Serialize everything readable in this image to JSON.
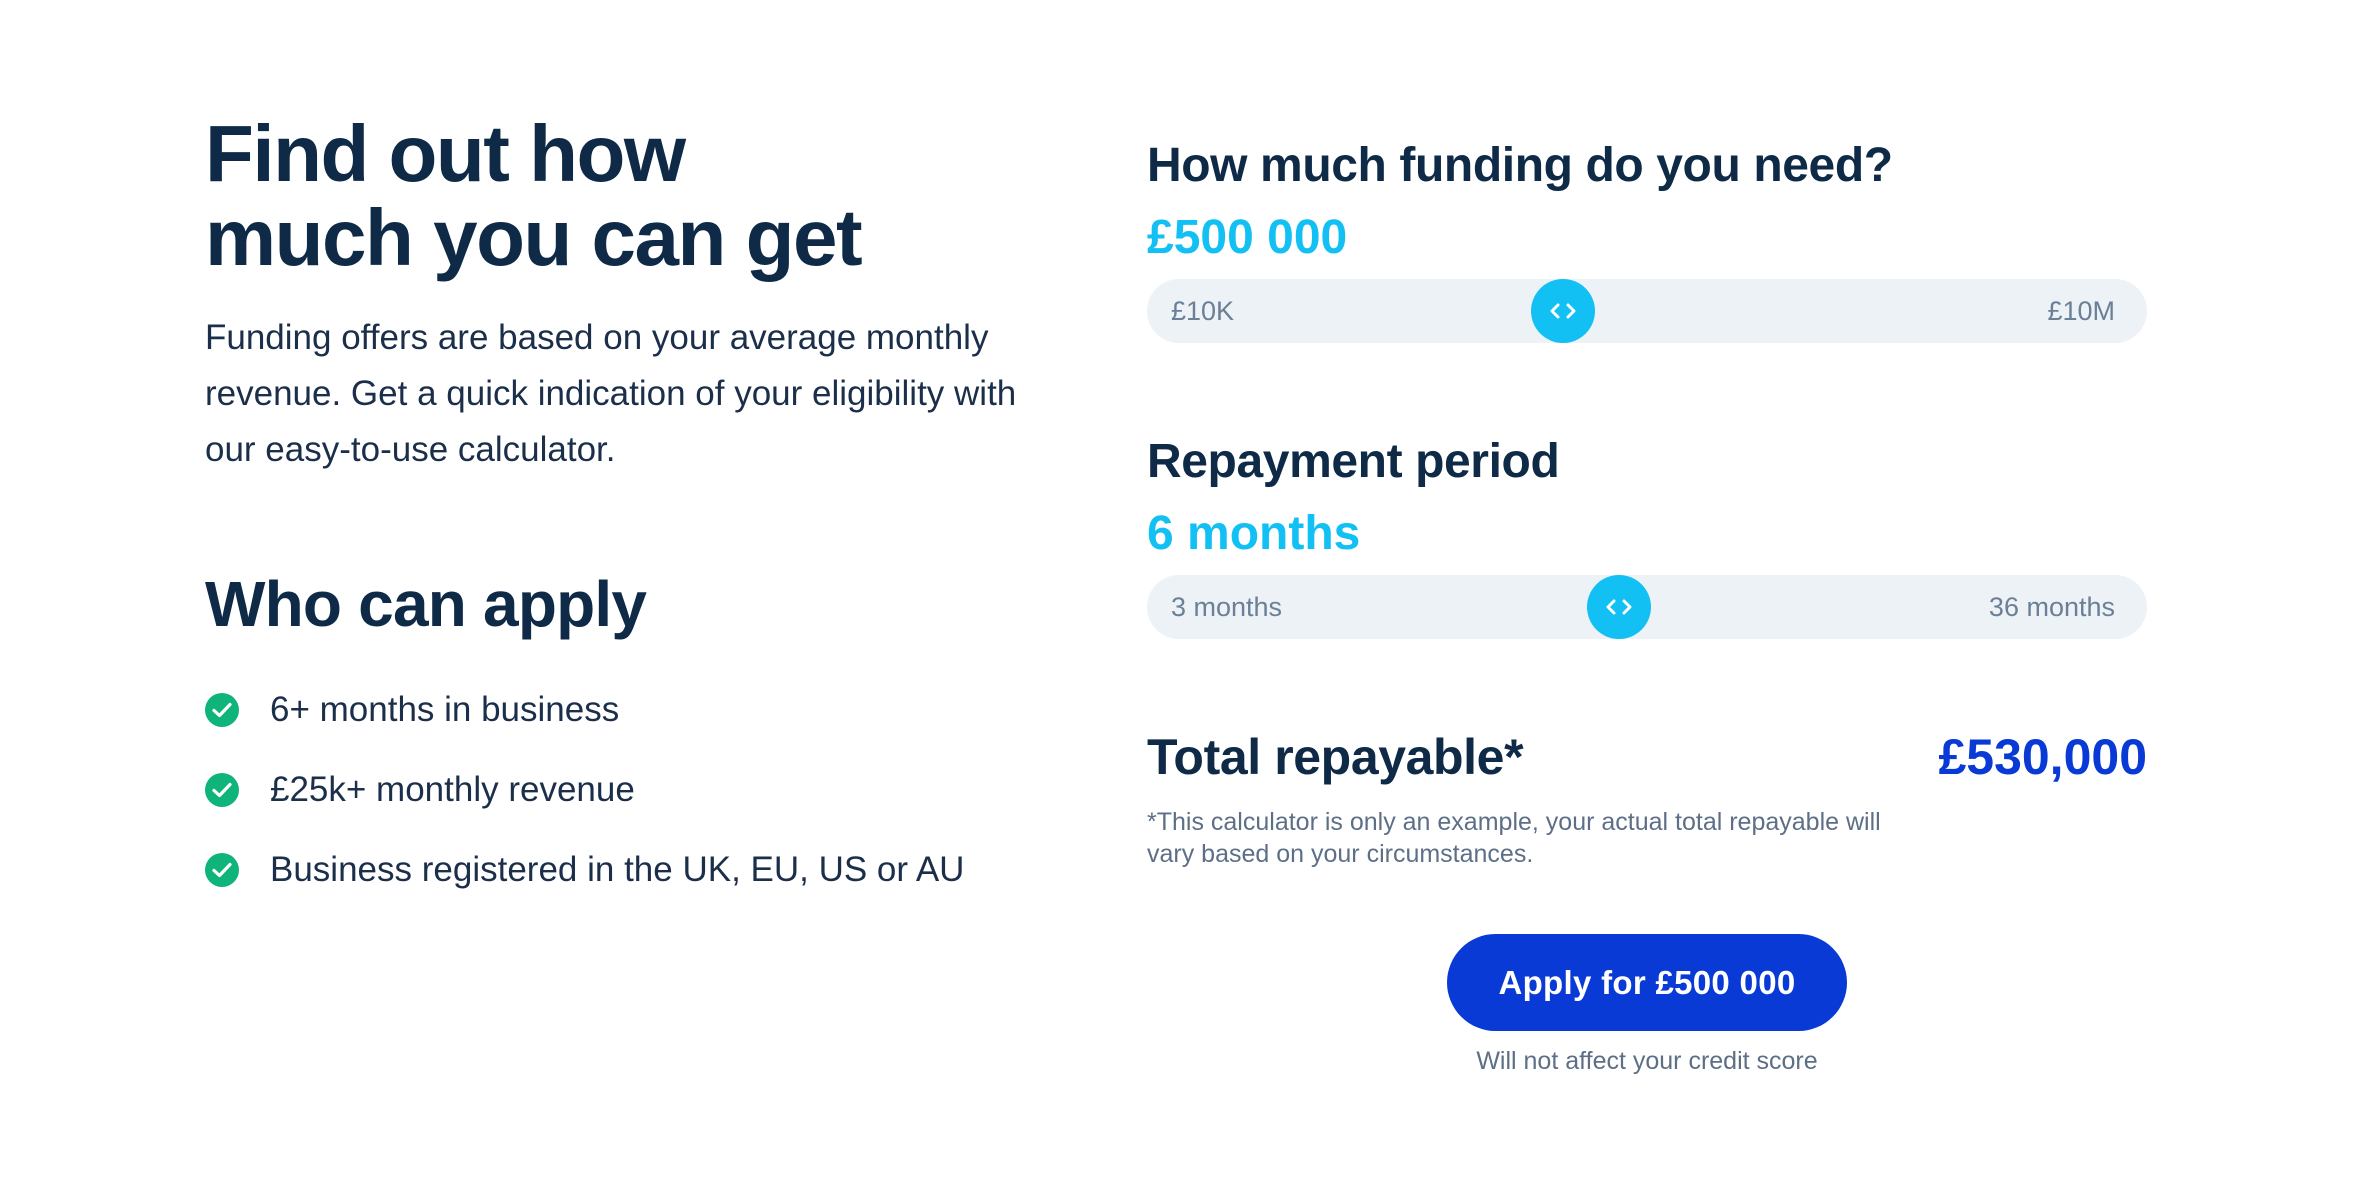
{
  "hero": {
    "title_line1": "Find out how",
    "title_line2": "much you can get",
    "description": "Funding offers are based on your average monthly revenue. Get a quick indication of your eligibility with our easy-to-use calculator."
  },
  "eligibility": {
    "title": "Who can apply",
    "items": [
      {
        "label": "6+ months in business",
        "icon": "check-circle-icon"
      },
      {
        "label": "£25k+ monthly revenue",
        "icon": "check-circle-icon"
      },
      {
        "label": "Business registered in the UK, EU, US or AU",
        "icon": "check-circle-icon"
      }
    ]
  },
  "calculator": {
    "funding": {
      "question": "How much funding do you need?",
      "value": "£500 000",
      "min_label": "£10K",
      "max_label": "£10M",
      "slider_fraction": 0.41,
      "thumb_icon": "chevrons-left-right-icon"
    },
    "period": {
      "question": "Repayment period",
      "value": "6 months",
      "min_label": "3 months",
      "max_label": "36 months",
      "slider_fraction": 0.47,
      "thumb_icon": "chevrons-left-right-icon"
    },
    "total": {
      "label": "Total repayable*",
      "value": "£530,000",
      "disclaimer": "*This calculator is only an example, your actual total repayable will vary based on your circumstances."
    },
    "apply_button_label": "Apply for £500 000",
    "credit_note": "Will not affect your credit score"
  },
  "colors": {
    "heading": "#0e2a47",
    "accent_cyan": "#12c0f3",
    "brand_blue": "#0a3ad6",
    "check_green": "#0fb47a",
    "track_bg": "#edf2f7"
  }
}
